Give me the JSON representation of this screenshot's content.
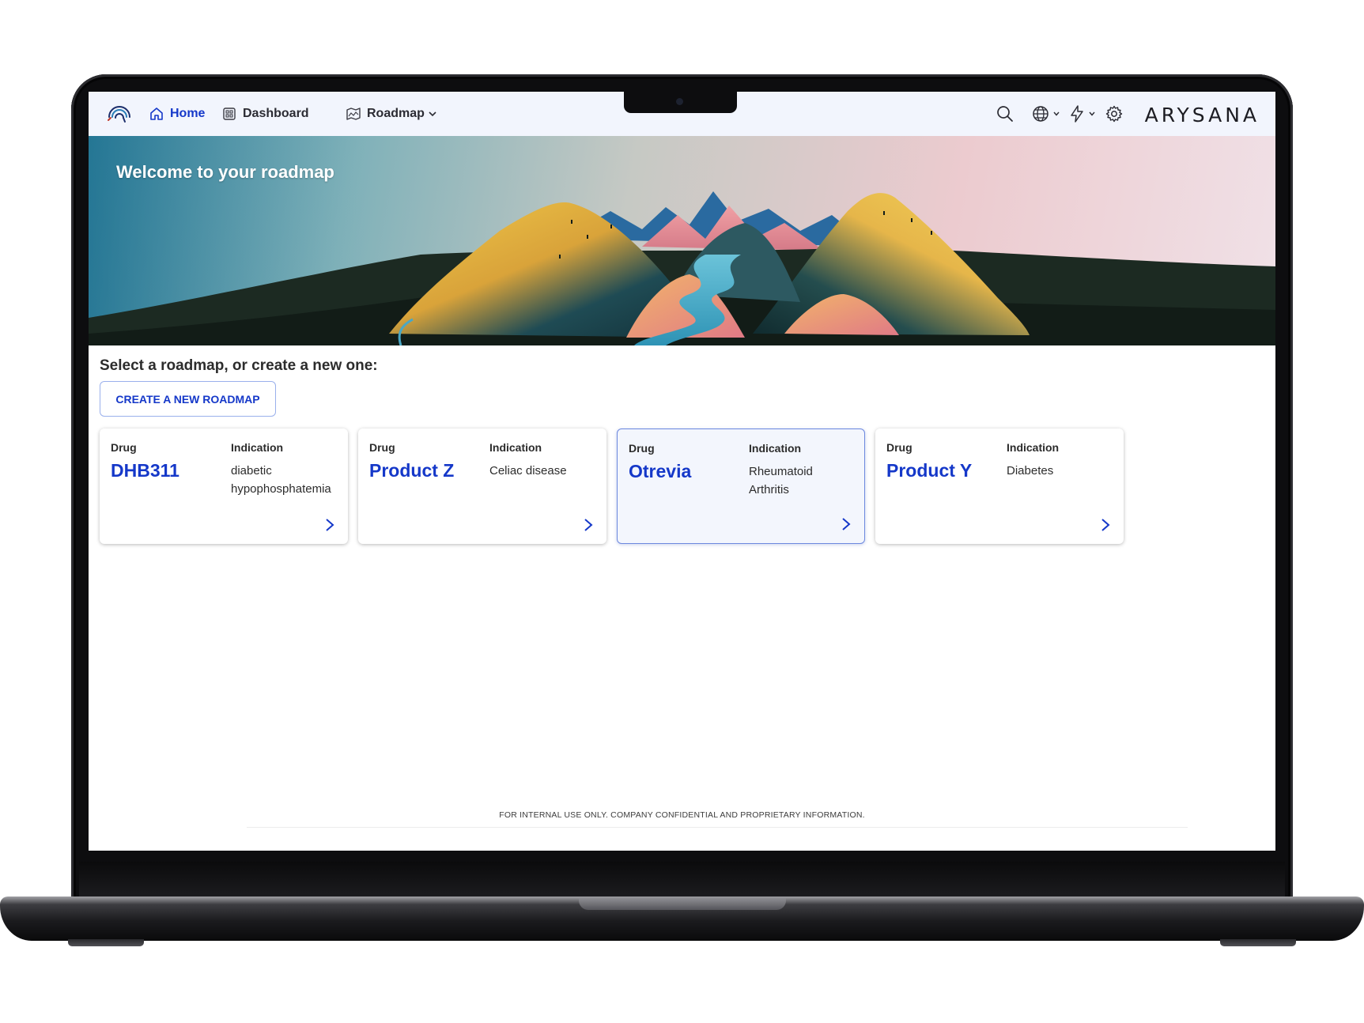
{
  "app": {
    "brand": "ARYSANA"
  },
  "nav": {
    "items": [
      {
        "label": "Home",
        "icon": "home-icon",
        "active": true
      },
      {
        "label": "Dashboard",
        "icon": "dashboard-icon",
        "active": false
      },
      {
        "label": "Roadmap",
        "icon": "roadmap-icon",
        "active": false,
        "dropdown": true
      }
    ]
  },
  "toolbar": {
    "icons": [
      "search-icon",
      "globe-icon",
      "lightning-icon",
      "gear-icon"
    ]
  },
  "hero": {
    "title": "Welcome to your roadmap"
  },
  "main": {
    "heading": "Select a roadmap, or create a new one:",
    "create_button": "CREATE A NEW ROADMAP",
    "drug_label": "Drug",
    "indication_label": "Indication",
    "cards": [
      {
        "drug": "DHB311",
        "indication": "diabetic hypophosphatemia",
        "selected": false
      },
      {
        "drug": "Product Z",
        "indication": "Celiac disease",
        "selected": false
      },
      {
        "drug": "Otrevia",
        "indication": "Rheumatoid Arthritis",
        "selected": true
      },
      {
        "drug": "Product Y",
        "indication": "Diabetes",
        "selected": false
      }
    ]
  },
  "footer": {
    "note": "FOR INTERNAL USE ONLY. COMPANY CONFIDENTIAL AND PROPRIETARY INFORMATION."
  },
  "colors": {
    "accent": "#1538c9",
    "topbar": "#f2f5fd",
    "text": "#2c2c2c"
  }
}
